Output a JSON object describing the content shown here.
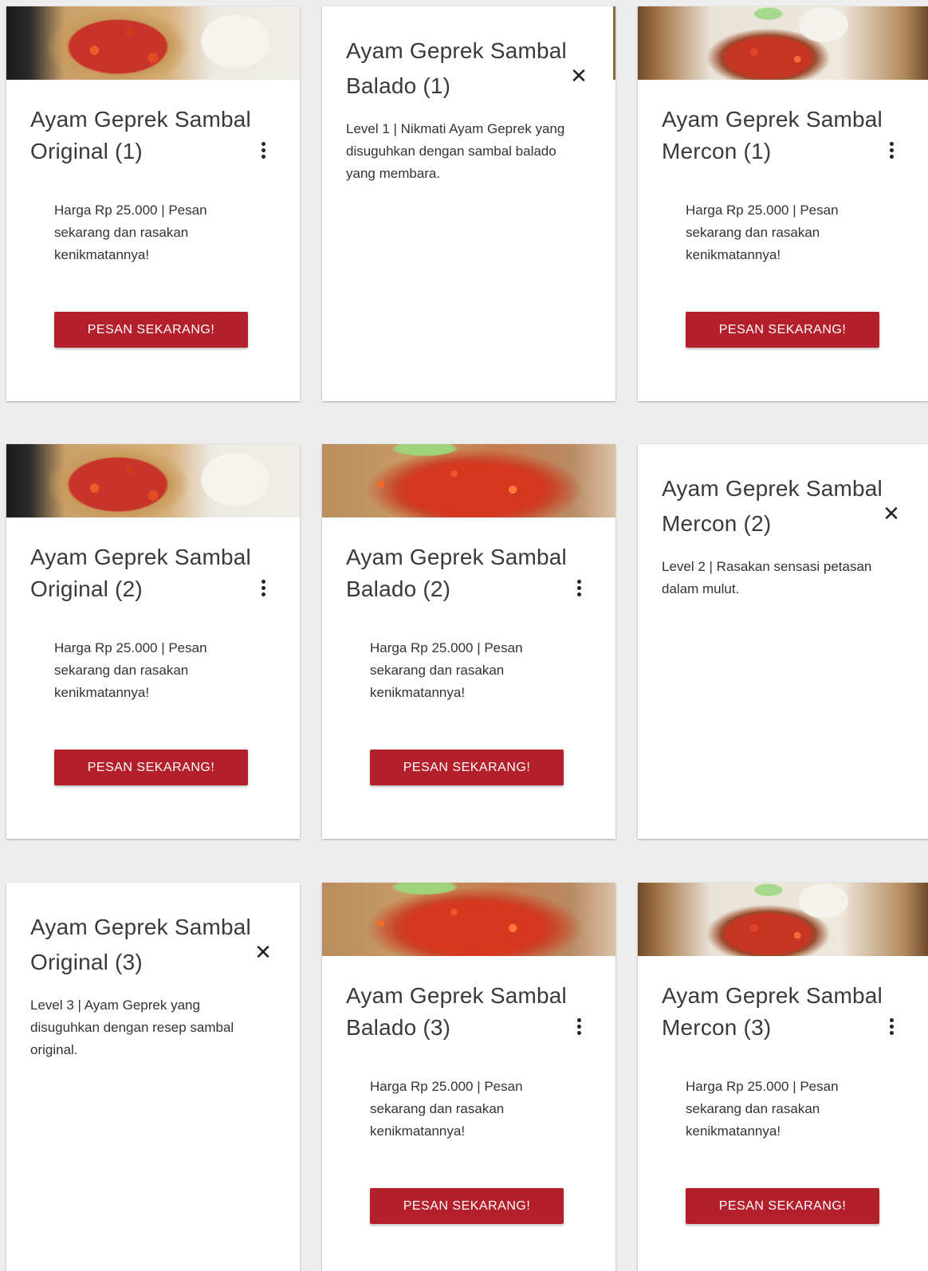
{
  "cta_label": "PESAN SEKARANG!",
  "price_text": "Harga Rp 25.000 | Pesan sekarang dan rasakan kenikmatannya!",
  "icons": {
    "more": "more-vert-icon",
    "close": "close-icon"
  },
  "colors": {
    "button": "#b3202b",
    "background": "#ededed",
    "card": "#ffffff"
  },
  "cards": [
    {
      "title": "Ayam Geprek Sambal Original (1)",
      "state": "front",
      "image": "original"
    },
    {
      "title": "Ayam Geprek Sambal Balado (1)",
      "state": "revealed",
      "description": "Level 1 | Nikmati Ayam Geprek yang disuguhkan dengan sambal balado yang membara."
    },
    {
      "title": "Ayam Geprek Sambal Mercon (1)",
      "state": "front",
      "image": "mercon"
    },
    {
      "title": "Ayam Geprek Sambal Original (2)",
      "state": "front",
      "image": "original"
    },
    {
      "title": "Ayam Geprek Sambal Balado (2)",
      "state": "front",
      "image": "balado"
    },
    {
      "title": "Ayam Geprek Sambal Mercon (2)",
      "state": "revealed",
      "description": "Level 2 | Rasakan sensasi petasan dalam mulut."
    },
    {
      "title": "Ayam Geprek Sambal Original (3)",
      "state": "revealed",
      "description": "Level 3 | Ayam Geprek yang disuguhkan dengan resep sambal original."
    },
    {
      "title": "Ayam Geprek Sambal Balado (3)",
      "state": "front",
      "image": "balado"
    },
    {
      "title": "Ayam Geprek Sambal Mercon (3)",
      "state": "front",
      "image": "mercon"
    }
  ]
}
